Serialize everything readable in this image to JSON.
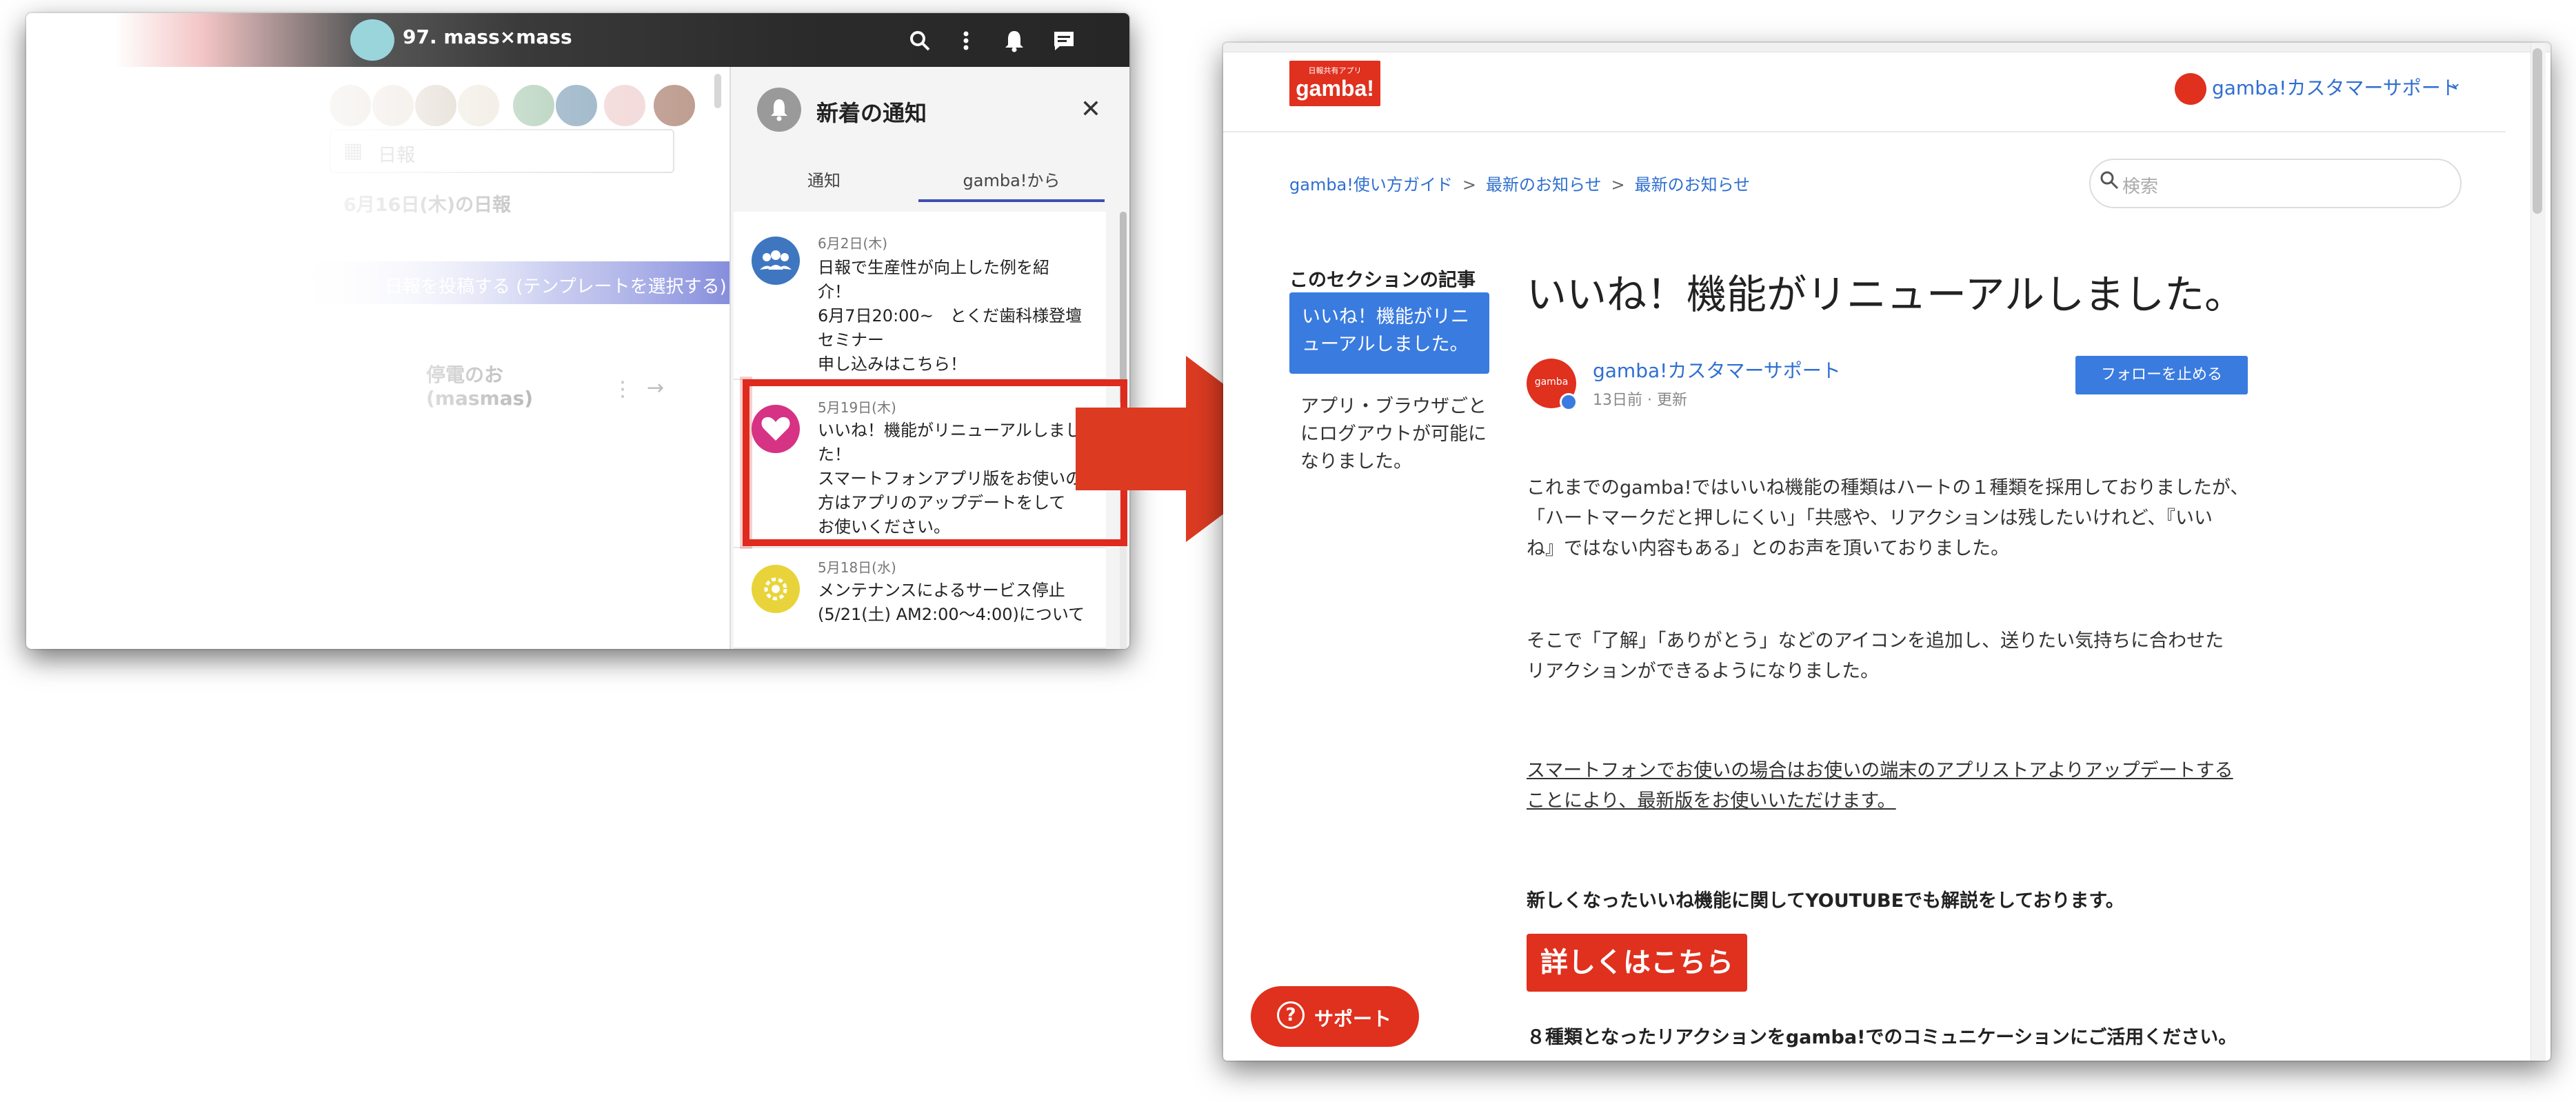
{
  "left_window": {
    "room_title": "97. mass×mass",
    "header_icons": [
      "search-icon",
      "kebab-icon",
      "bell-icon",
      "chat-icon"
    ],
    "daily_select_label": "日報",
    "daily_date_label": "6月16日(木)の日報",
    "post_bar_label": "日報を投稿する (テンプレートを選択する)",
    "outage_card_title": "停電のお\n(masmas)",
    "notification_panel": {
      "title": "新着の通知",
      "tabs": [
        "通知",
        "gamba!から"
      ],
      "active_tab": "gamba!から",
      "items": [
        {
          "date": "6月2日(木)",
          "text": "日報で生産性が向上した例を紹\n介！\n6月7日20:00~　とくだ歯科様登壇\nセミナー\n申し込みはこちら！",
          "icon": "group-icon",
          "icon_color": "#3f76c0"
        },
        {
          "date": "5月19日(木)",
          "text": "いいね！機能がリニューアルしまし\nた！\nスマートフォンアプリ版をお使いの\n方はアプリのアップデートをして\nお使いください。",
          "icon": "heart-icon",
          "icon_color": "#d63384"
        },
        {
          "date": "5月18日(水)",
          "text": "メンテナンスによるサービス停止\n(5/21(土) AM2:00〜4:00)について",
          "icon": "gear-icon",
          "icon_color": "#e8d43a"
        }
      ]
    }
  },
  "right_window": {
    "logo_small": "日報共有アプリ",
    "logo_text": "gamba!",
    "account_name": "gamba!カスタマーサポート",
    "breadcrumb": [
      "gamba!使い方ガイド",
      "最新のお知らせ",
      "最新のお知らせ"
    ],
    "search_placeholder": "検索",
    "section_heading": "このセクションの記事",
    "section_items": [
      "いいね！機能がリニューアルしました。",
      "アプリ・ブラウザごとにログアウトが可能になりました。"
    ],
    "article_title": "いいね！機能がリニューアルしました。",
    "author_name": "gamba!カスタマーサポート",
    "author_avatar_text": "gamba",
    "author_meta": "13日前 · 更新",
    "follow_button": "フォローを止める",
    "paragraphs": [
      "これまでのgamba!ではいいね機能の種類はハートの１種類を採用しておりましたが、",
      "「ハートマークだと押しにくい」「共感や、リアクションは残したいけれど、『いい",
      "ね』ではない内容もある」とのお声を頂いておりました。",
      "そこで「了解」「ありがとう」などのアイコンを追加し、送りたい気持ちに合わせた",
      "リアクションができるようになりました。"
    ],
    "link_lines": [
      "スマートフォンでお使いの場合はお使いの端末のアプリストアよりアップデートする",
      "ことにより、最新版をお使いいただけます。"
    ],
    "youtube_text": "新しくなったいいね機能に関してYOUTUBEでも解説をしております。",
    "detail_button": "詳しくはこちら",
    "reaction_text": "８種類となったリアクションをgamba!でのコミュニケーションにご活用ください。",
    "support_button": "サポート"
  },
  "colors": {
    "highlight": "#df2a1e",
    "arrow": "#dc3b22",
    "brand_red": "#e0301e",
    "link_blue": "#2f6fd0",
    "accent_blue": "#3a7be0"
  }
}
